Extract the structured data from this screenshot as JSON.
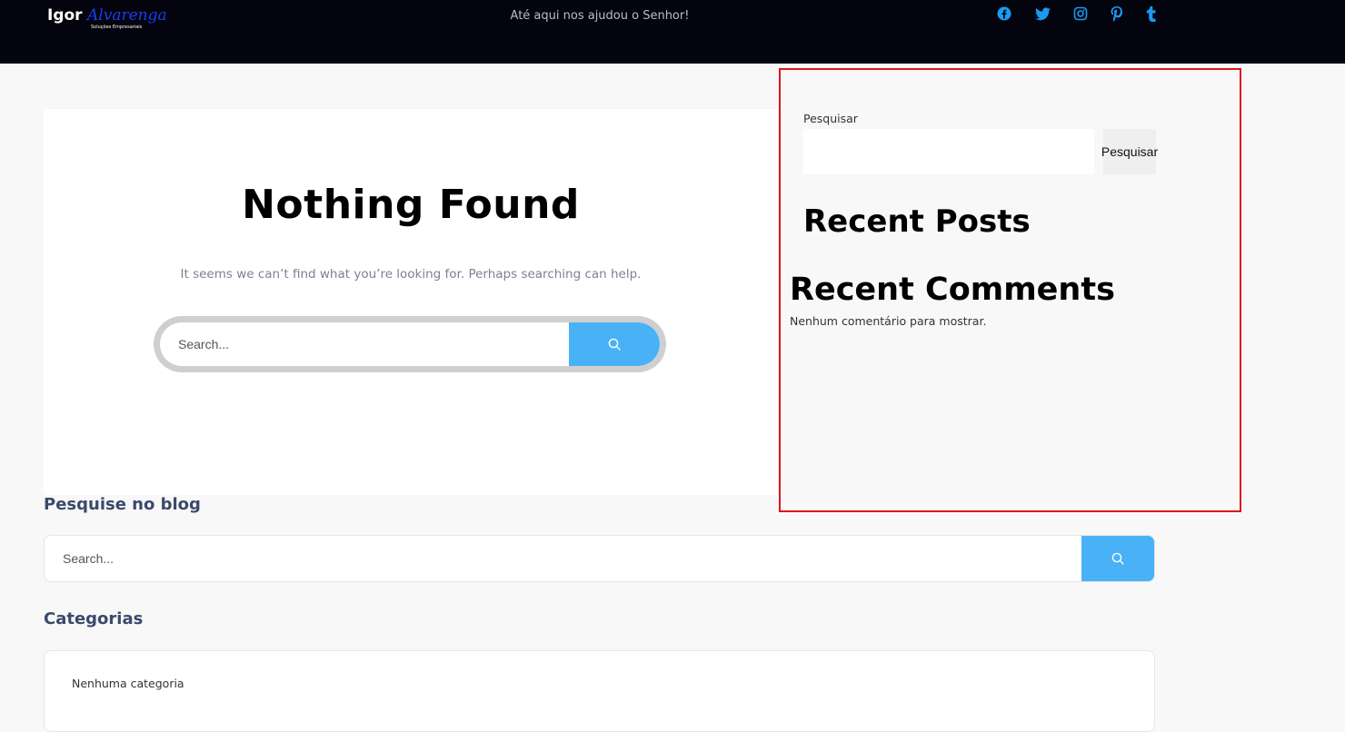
{
  "header": {
    "logo": {
      "name": "Igor",
      "script": "Alvarenga",
      "tag": "Soluções Empresariais"
    },
    "tagline": "Até aqui nos ajudou o Senhor!",
    "social": [
      "facebook-icon",
      "twitter-icon",
      "instagram-icon",
      "pinterest-icon",
      "tumblr-icon"
    ],
    "accent": "#1a9bf0"
  },
  "main": {
    "title": "Nothing Found",
    "message": "It seems we can’t find what you’re looking for. Perhaps searching can help.",
    "search_placeholder": "Search...",
    "search_button_color": "#49b1f5"
  },
  "sidebar": {
    "search_label": "Pesquisar",
    "search_button": "Pesquisar",
    "recent_posts": "Recent Posts",
    "recent_comments": "Recent Comments",
    "no_comments": "Nenhum comentário para mostrar.",
    "highlight_color": "#e0141c"
  },
  "blog": {
    "search_heading": "Pesquise no blog",
    "search_placeholder": "Search...",
    "categories_heading": "Categorias",
    "categories_empty": "Nenhuma categoria"
  }
}
